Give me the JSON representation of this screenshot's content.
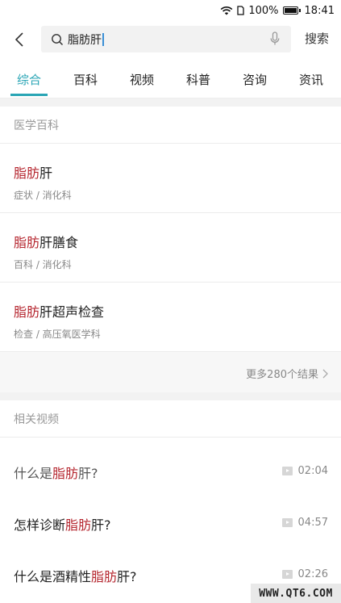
{
  "status_bar": {
    "battery": "100%",
    "time": "18:41"
  },
  "search": {
    "query": "脂肪肝",
    "button_label": "搜索"
  },
  "tabs": [
    {
      "label": "综合",
      "active": true
    },
    {
      "label": "百科",
      "active": false
    },
    {
      "label": "视频",
      "active": false
    },
    {
      "label": "科普",
      "active": false
    },
    {
      "label": "咨询",
      "active": false
    },
    {
      "label": "资讯",
      "active": false
    }
  ],
  "encyclopedia": {
    "header": "医学百科",
    "items": [
      {
        "highlight": "脂肪",
        "rest": "肝",
        "sub": "症状 / 消化科"
      },
      {
        "highlight": "脂肪",
        "rest": "肝膳食",
        "sub": "百科 / 消化科"
      },
      {
        "highlight": "脂肪",
        "rest": "肝超声检查",
        "sub": "检查 / 高压氧医学科"
      }
    ],
    "more_label": "更多280个结果"
  },
  "videos": {
    "header": "相关视频",
    "items": [
      {
        "prefix": "什么是",
        "highlight": "脂肪",
        "suffix": "肝?",
        "duration": "02:04"
      },
      {
        "prefix": "怎样诊断",
        "highlight": "脂肪",
        "suffix": "肝?",
        "duration": "04:57"
      },
      {
        "prefix": "什么是酒精性",
        "highlight": "脂肪",
        "suffix": "肝?",
        "duration": "02:26"
      }
    ]
  },
  "watermark": "WWW.QT6.COM",
  "colors": {
    "accent": "#2aa5b5",
    "highlight": "#b5262f"
  }
}
